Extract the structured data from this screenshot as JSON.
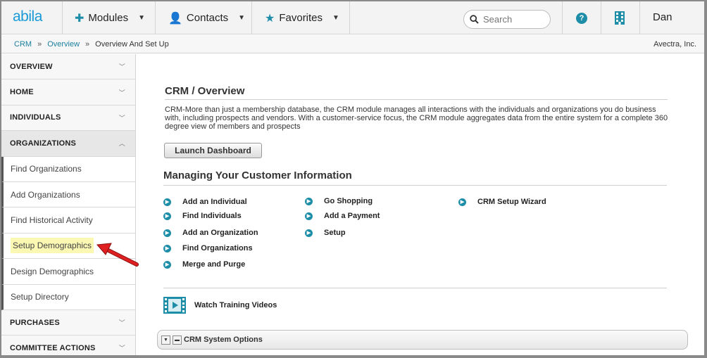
{
  "app": {
    "logo": "abila"
  },
  "topnav": {
    "modules": "Modules",
    "contacts": "Contacts",
    "favorites": "Favorites",
    "search_placeholder": "Search",
    "user": "Dan"
  },
  "breadcrumb": {
    "items": [
      "CRM",
      "Overview",
      "Overview And Set Up"
    ],
    "separator": "»",
    "org": "Avectra, Inc."
  },
  "sidebar": {
    "overview": "OVERVIEW",
    "home": "HOME",
    "individuals": "INDIVIDUALS",
    "organizations": "ORGANIZATIONS",
    "sub": [
      "Find Organizations",
      "Add Organizations",
      "Find Historical Activity",
      "Setup Demographics",
      "Design Demographics",
      "Setup Directory"
    ],
    "purchases": "PURCHASES",
    "committee": "COMMITTEE ACTIONS"
  },
  "main": {
    "title": "CRM / Overview",
    "description": "CRM-More than just a membership database, the CRM module manages all interactions with the individuals and organizations you do business with, including prospects and vendors. With a customer-service focus, the CRM module aggregates data from the entire system for a complete 360 degree view of members and prospects",
    "launch_button": "Launch Dashboard",
    "subtitle": "Managing Your Customer Information",
    "col1": [
      "Add an Individual",
      "Find Individuals",
      "Add an Organization",
      "Find Organizations",
      "Merge and Purge"
    ],
    "col2": [
      "Go Shopping",
      "Add a Payment",
      "Setup"
    ],
    "col3": [
      "CRM Setup Wizard"
    ],
    "videos": "Watch Training Videos",
    "options": "CRM System Options"
  },
  "colors": {
    "accent": "#1e8ea8",
    "logo": "#1a9ad6",
    "highlight": "#fbf8b3",
    "arrow": "#e02020"
  }
}
